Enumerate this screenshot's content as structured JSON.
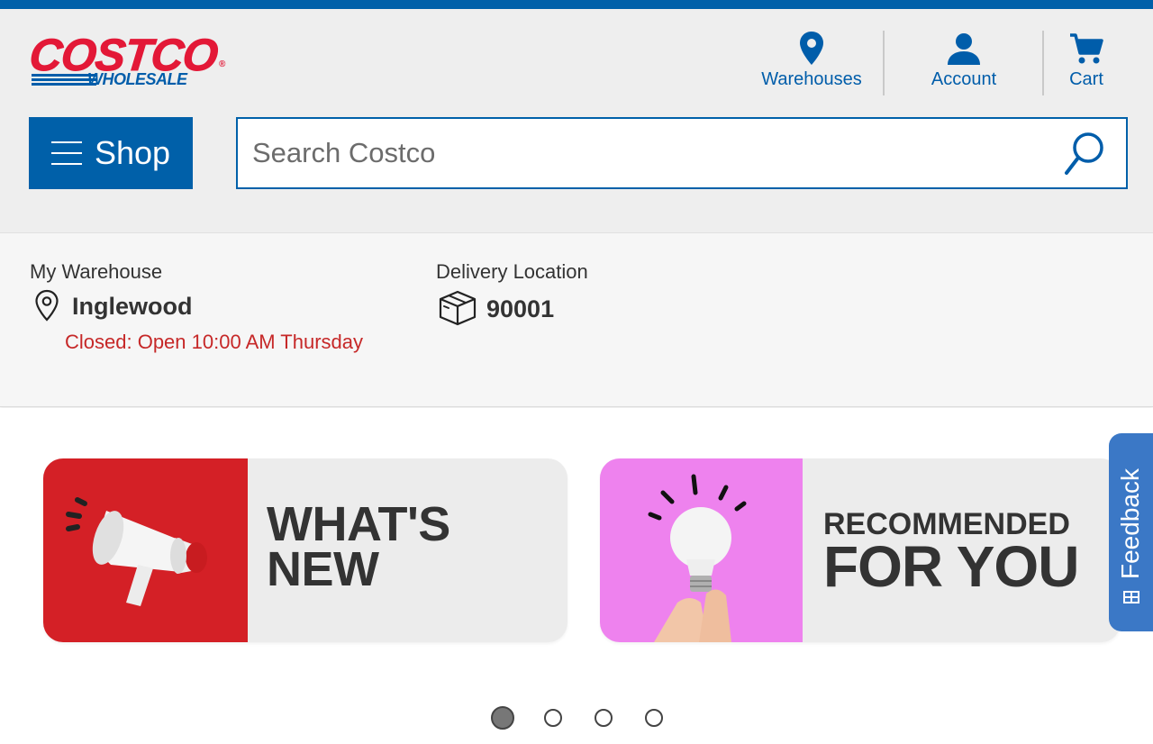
{
  "brand": {
    "logo_main": "COSTCO",
    "logo_sub": "WHOLESALE",
    "logo_reg": "®",
    "primary_color": "#0060a9",
    "logo_red": "#e31837"
  },
  "header_nav": {
    "warehouses": {
      "label": "Warehouses",
      "icon": "location-pin-icon"
    },
    "account": {
      "label": "Account",
      "icon": "user-icon"
    },
    "cart": {
      "label": "Cart",
      "icon": "cart-icon"
    }
  },
  "shop": {
    "label": "Shop",
    "icon": "hamburger-menu-icon"
  },
  "search": {
    "placeholder": "Search Costco",
    "icon": "search-icon"
  },
  "my_warehouse": {
    "label": "My Warehouse",
    "name": "Inglewood",
    "status": "Closed: Open 10:00 AM Thursday",
    "status_color": "#c62828",
    "icon": "location-pin-outline-icon"
  },
  "delivery": {
    "label": "Delivery Location",
    "zip": "90001",
    "icon": "box-icon"
  },
  "banners": [
    {
      "line1": "WHAT'S",
      "line2": "NEW",
      "image": "megaphone",
      "bg": "#d42026"
    },
    {
      "line1": "RECOMMENDED",
      "line2": "FOR YOU",
      "image": "lightbulb",
      "bg": "#ee82ee"
    }
  ],
  "feedback": {
    "label": "Feedback",
    "color": "#3b78c6"
  },
  "carousel": {
    "count": 4,
    "active": 1
  }
}
